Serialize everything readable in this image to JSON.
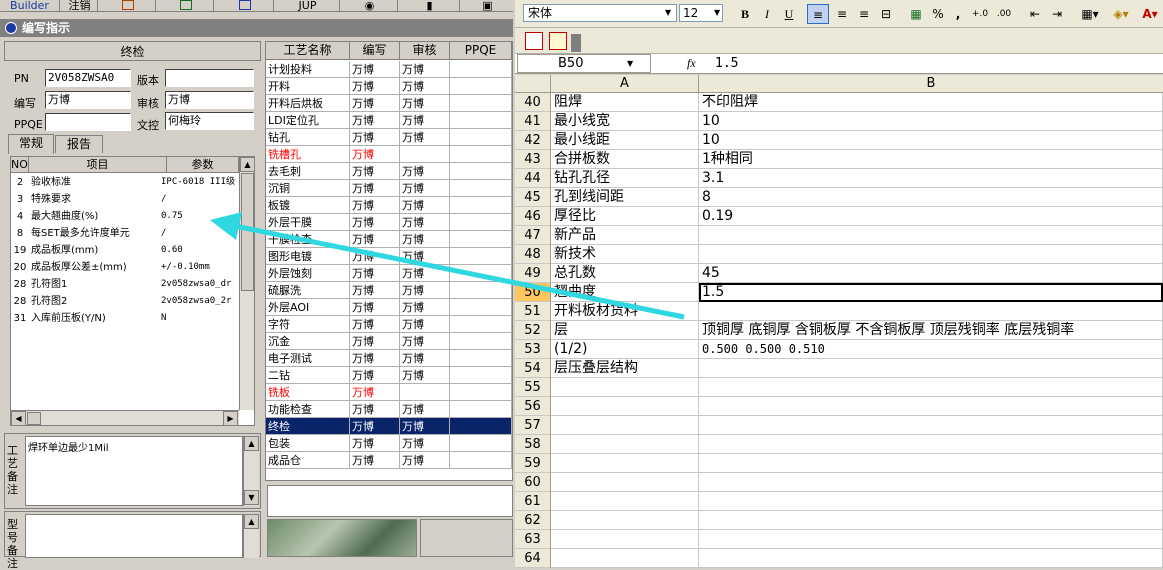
{
  "app": {
    "toolbar": {
      "builder": "Builder",
      "zhuxiao": "注销",
      "jup": "JUP"
    },
    "dialog_title": "编写指示",
    "left": {
      "stage_title": "终检",
      "pn_label": "PN",
      "pn_value": "2V058ZWSA0",
      "version_label": "版本",
      "version_value": "",
      "writer_label": "编写",
      "writer_value": "万博",
      "reviewer_label": "审核",
      "reviewer_value": "万博",
      "ppqe_label": "PPQE",
      "ppqe_value": "",
      "doc_control_label": "文控",
      "doc_control_value": "何梅玲",
      "tabs": [
        "常规",
        "报告"
      ],
      "grid_headers": {
        "no": "NO",
        "item": "项目",
        "param": "参数"
      },
      "rows": [
        {
          "no": "2",
          "item": "验收标准",
          "param": "IPC-6018 III级"
        },
        {
          "no": "3",
          "item": "特殊要求",
          "param": "/"
        },
        {
          "no": "4",
          "item": "最大翘曲度(%)",
          "param": "0.75"
        },
        {
          "no": "8",
          "item": "每SET最多允许度单元",
          "param": "/"
        },
        {
          "no": "19",
          "item": "成品板厚(mm)",
          "param": "0.60"
        },
        {
          "no": "20",
          "item": "成品板厚公差±(mm)",
          "param": "+/-0.10mm"
        },
        {
          "no": "28",
          "item": "孔符图1",
          "param": "2v058zwsa0_dr"
        },
        {
          "no": "28",
          "item": "孔符图2",
          "param": "2v058zwsa0_2r"
        },
        {
          "no": "31",
          "item": "入库前压板(Y/N)",
          "param": "N"
        }
      ],
      "process_note_label": "工艺备注",
      "process_note_text": "焊环单边最少1Mil",
      "model_note_label": "型号备注"
    },
    "process": {
      "headers": [
        "工艺名称",
        "编写",
        "审核",
        "PPQE"
      ],
      "rows": [
        {
          "name": "计划投料",
          "w": "万博",
          "r": "万博",
          "red": false
        },
        {
          "name": "开料",
          "w": "万博",
          "r": "万博",
          "red": false
        },
        {
          "name": "开料后烘板",
          "w": "万博",
          "r": "万博",
          "red": false
        },
        {
          "name": "LDI定位孔",
          "w": "万博",
          "r": "万博",
          "red": false
        },
        {
          "name": "钻孔",
          "w": "万博",
          "r": "万博",
          "red": false
        },
        {
          "name": "铣槽孔",
          "w": "万博",
          "r": "",
          "red": true
        },
        {
          "name": "去毛刺",
          "w": "万博",
          "r": "万博",
          "red": false
        },
        {
          "name": "沉铜",
          "w": "万博",
          "r": "万博",
          "red": false
        },
        {
          "name": "板镀",
          "w": "万博",
          "r": "万博",
          "red": false
        },
        {
          "name": "外层干膜",
          "w": "万博",
          "r": "万博",
          "red": false
        },
        {
          "name": "干膜检查",
          "w": "万博",
          "r": "万博",
          "red": false
        },
        {
          "name": "图形电镀",
          "w": "万博",
          "r": "万博",
          "red": false
        },
        {
          "name": "外层蚀刻",
          "w": "万博",
          "r": "万博",
          "red": false
        },
        {
          "name": "硫脲洗",
          "w": "万博",
          "r": "万博",
          "red": false
        },
        {
          "name": "外层AOI",
          "w": "万博",
          "r": "万博",
          "red": false
        },
        {
          "name": "字符",
          "w": "万博",
          "r": "万博",
          "red": false
        },
        {
          "name": "沉金",
          "w": "万博",
          "r": "万博",
          "red": false
        },
        {
          "name": "电子测试",
          "w": "万博",
          "r": "万博",
          "red": false
        },
        {
          "name": "二钻",
          "w": "万博",
          "r": "万博",
          "red": false
        },
        {
          "name": "铣板",
          "w": "万博",
          "r": "",
          "red": true
        },
        {
          "name": "功能检查",
          "w": "万博",
          "r": "万博",
          "red": false
        },
        {
          "name": "终检",
          "w": "万博",
          "r": "万博",
          "red": false,
          "selected": true
        },
        {
          "name": "包装",
          "w": "万博",
          "r": "万博",
          "red": false
        },
        {
          "name": "成品仓",
          "w": "万博",
          "r": "万博",
          "red": false
        }
      ]
    },
    "excel": {
      "font_name": "宋体",
      "font_size": "12",
      "bold": "B",
      "italic": "I",
      "underline": "U",
      "percent": "%",
      "comma": ",",
      "name_box": "B50",
      "fx": "fx",
      "formula": "1.5",
      "col_a": "A",
      "col_b": "B",
      "rows": [
        {
          "n": "40",
          "a": "阻焊",
          "b": "不印阻焊"
        },
        {
          "n": "41",
          "a": "最小线宽",
          "b": "10"
        },
        {
          "n": "42",
          "a": "最小线距",
          "b": "10"
        },
        {
          "n": "43",
          "a": "合拼板数",
          "b": "1种相同"
        },
        {
          "n": "44",
          "a": "钻孔孔径",
          "b": "3.1"
        },
        {
          "n": "45",
          "a": "孔到线间距",
          "b": "8"
        },
        {
          "n": "46",
          "a": "厚径比",
          "b": "0.19"
        },
        {
          "n": "47",
          "a": "新产品",
          "b": ""
        },
        {
          "n": "48",
          "a": "新技术",
          "b": ""
        },
        {
          "n": "49",
          "a": "总孔数",
          "b": "45"
        },
        {
          "n": "50",
          "a": "翘曲度",
          "b": "1.5"
        },
        {
          "n": "51",
          "a": "开料板材货料",
          "b": ""
        },
        {
          "n": "52",
          "a": "层",
          "b": "顶铜厚 底铜厚 含铜板厚 不含铜板厚 顶层残铜率 底层残铜率"
        },
        {
          "n": "53",
          "a": "(1/2)",
          "b": "0.500  0.500              0.510"
        },
        {
          "n": "54",
          "a": "层压叠层结构",
          "b": ""
        },
        {
          "n": "55",
          "a": "",
          "b": ""
        },
        {
          "n": "56",
          "a": "",
          "b": ""
        },
        {
          "n": "57",
          "a": "",
          "b": ""
        },
        {
          "n": "58",
          "a": "",
          "b": ""
        },
        {
          "n": "59",
          "a": "",
          "b": ""
        },
        {
          "n": "60",
          "a": "",
          "b": ""
        },
        {
          "n": "61",
          "a": "",
          "b": ""
        },
        {
          "n": "62",
          "a": "",
          "b": ""
        },
        {
          "n": "63",
          "a": "",
          "b": ""
        },
        {
          "n": "64",
          "a": "",
          "b": ""
        }
      ]
    },
    "colors": {
      "arrow": "#2fd8e0",
      "selected_row": "#0a246a",
      "red_text": "#ff0000"
    }
  }
}
